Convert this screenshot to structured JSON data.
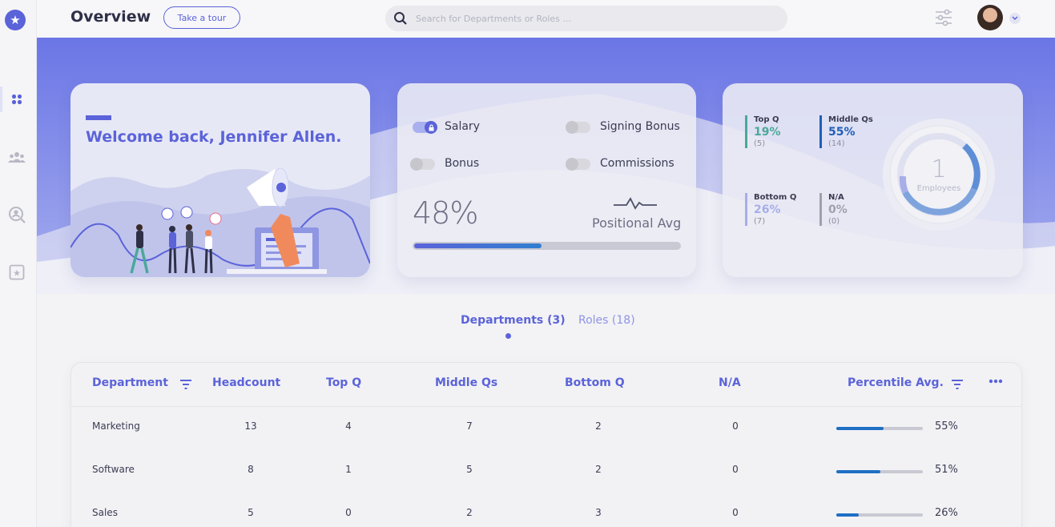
{
  "header": {
    "title": "Overview",
    "tour_label": "Take a tour",
    "search_placeholder": "Search for Departments or Roles ..."
  },
  "sidebar": {
    "items": [
      "dashboard",
      "teams",
      "search-people",
      "starred"
    ]
  },
  "welcome": {
    "text": "Welcome back, Jennifer Allen."
  },
  "compensation": {
    "toggles": [
      {
        "label": "Salary",
        "on": true
      },
      {
        "label": "Signing Bonus",
        "on": false
      },
      {
        "label": "Bonus",
        "on": false
      },
      {
        "label": "Commissions",
        "on": false
      }
    ],
    "percent": "48%",
    "percent_value": 48,
    "positional_label": "Positional Avg"
  },
  "stats": {
    "top_q": {
      "label": "Top Q",
      "pct": "19%",
      "count": "(5)",
      "color": "#4aa89a"
    },
    "middle_qs": {
      "label": "Middle Qs",
      "pct": "55%",
      "count": "(14)",
      "color": "#1f5fb8"
    },
    "bottom_q": {
      "label": "Bottom Q",
      "pct": "26%",
      "count": "(7)",
      "color": "#a7aee8"
    },
    "na": {
      "label": "N/A",
      "pct": "0%",
      "count": "(0)",
      "color": "#a0a0aa"
    },
    "employees_num": "1",
    "employees_label": "Employees"
  },
  "tabs": {
    "departments": "Departments (3)",
    "roles": "Roles (18)"
  },
  "table": {
    "headers": [
      "Department",
      "Headcount",
      "Top Q",
      "Middle Qs",
      "Bottom Q",
      "N/A",
      "Percentile Avg."
    ],
    "rows": [
      {
        "department": "Marketing",
        "headcount": "13",
        "top_q": "4",
        "middle_qs": "7",
        "bottom_q": "2",
        "na": "0",
        "avg": "55%",
        "avg_value": 55
      },
      {
        "department": "Software",
        "headcount": "8",
        "top_q": "1",
        "middle_qs": "5",
        "bottom_q": "2",
        "na": "0",
        "avg": "51%",
        "avg_value": 51
      },
      {
        "department": "Sales",
        "headcount": "5",
        "top_q": "0",
        "middle_qs": "2",
        "bottom_q": "3",
        "na": "0",
        "avg": "26%",
        "avg_value": 26
      }
    ]
  },
  "colors": {
    "accent": "#5b63d9",
    "bar_fill": "#1f6fc5"
  }
}
